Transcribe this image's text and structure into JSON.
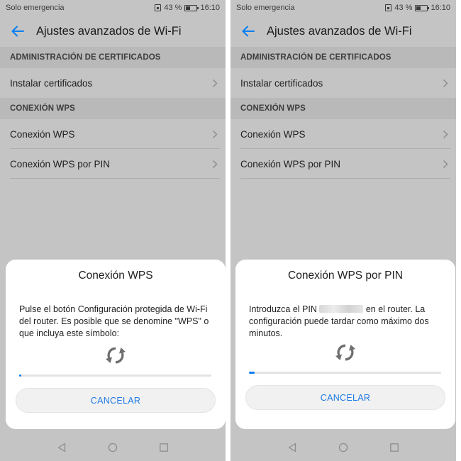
{
  "colors": {
    "accent": "#0a7ff2",
    "scrim": "#c4c4c4",
    "dialog": "#ffffff"
  },
  "screens": [
    {
      "status": {
        "carrier": "Solo emergencia",
        "battery": "43 %",
        "battery_level": 0.43,
        "time": "16:10"
      },
      "header": {
        "title": "Ajustes avanzados de Wi-Fi",
        "back_icon": "back-arrow-icon"
      },
      "sections": [
        {
          "title": "ADMINISTRACIÓN DE CERTIFICADOS",
          "items": [
            "Instalar certificados"
          ]
        },
        {
          "title": "CONEXIÓN WPS",
          "items": [
            "Conexión WPS",
            "Conexión WPS por PIN"
          ]
        }
      ],
      "dialog": {
        "title": "Conexión WPS",
        "body": "Pulse el botón Configuración protegida de Wi-Fi del router. Es posible que se denomine \"WPS\" o que incluya este símbolo:",
        "icon": "wps-icon",
        "progress": 0.01,
        "cancel_label": "CANCELAR"
      }
    },
    {
      "status": {
        "carrier": "Solo emergencia",
        "battery": "43 %",
        "battery_level": 0.43,
        "time": "16:10"
      },
      "header": {
        "title": "Ajustes avanzados de Wi-Fi",
        "back_icon": "back-arrow-icon"
      },
      "sections": [
        {
          "title": "ADMINISTRACIÓN DE CERTIFICADOS",
          "items": [
            "Instalar certificados"
          ]
        },
        {
          "title": "CONEXIÓN WPS",
          "items": [
            "Conexión WPS",
            "Conexión WPS por PIN"
          ]
        }
      ],
      "dialog": {
        "title": "Conexión WPS por PIN",
        "body_before_pin": "Introduzca el PIN ",
        "body_after_pin": " en el router. La configuración puede tardar como máximo dos minutos.",
        "icon": "wps-icon",
        "progress": 0.03,
        "cancel_label": "CANCELAR"
      }
    }
  ],
  "nav": {
    "icons": [
      "back-triangle-icon",
      "home-circle-icon",
      "recents-square-icon"
    ]
  }
}
